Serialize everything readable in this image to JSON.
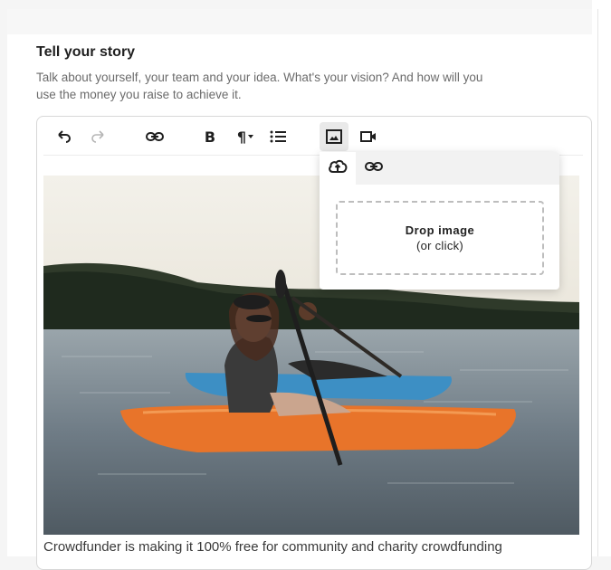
{
  "section": {
    "title": "Tell your story",
    "description": "Talk about yourself, your team and your idea. What's your vision? And how will you use the money you raise to achieve it."
  },
  "toolbar": {
    "items": [
      {
        "name": "undo-icon"
      },
      {
        "name": "redo-icon"
      },
      {
        "name": "link-icon"
      },
      {
        "name": "bold-button",
        "label": "B"
      },
      {
        "name": "paragraph-format-button",
        "label": "¶"
      },
      {
        "name": "bullet-list-icon"
      },
      {
        "name": "image-icon",
        "active": true
      },
      {
        "name": "video-icon"
      }
    ]
  },
  "image_popover": {
    "tabs": [
      {
        "name": "upload-cloud-icon",
        "active": true
      },
      {
        "name": "link-icon",
        "active": false
      }
    ],
    "dropzone_title": "Drop image",
    "dropzone_subtitle": "(or click)"
  },
  "editor": {
    "caption": "Crowdfunder is making it 100% free for community and charity crowdfunding"
  },
  "colors": {
    "kayak_front": "#e8742a",
    "kayak_back": "#3d8fc4",
    "water": "#6e7f8c",
    "sky": "#e9e6dc"
  }
}
